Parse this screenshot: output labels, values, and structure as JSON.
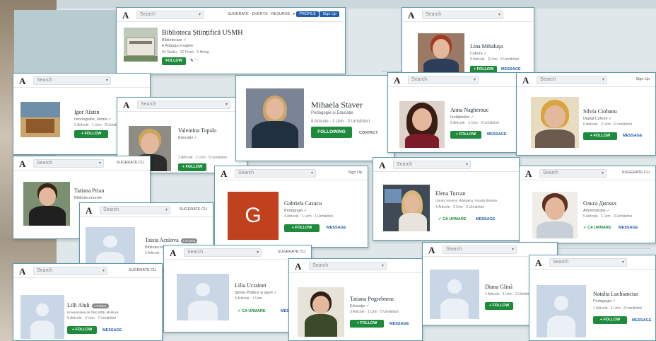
{
  "logo": "A",
  "search_placeholder": "Search",
  "buttons": {
    "follow": "+ FOLLOW",
    "message": "MESSAGE",
    "unfollow": "✓ CA URMARE",
    "contact": "CONTACT"
  },
  "nav": {
    "top_right": "Sign Up",
    "nav_alt": "SUGERATE CU"
  },
  "main_card": {
    "title": "Biblioteca Științifică USMH",
    "meta": "Bibliotecare ✓",
    "stats": "94 Studiu · 12 Posts · 0 Hiring",
    "follow": "FOLLOW"
  },
  "profiles": [
    {
      "id": "lina",
      "name": "Lina Mihalușa",
      "meta": "Cultura ✓",
      "stats": "9 Articole · 3 Urm · 5 Urmăritori"
    },
    {
      "id": "igor",
      "name": "Igor Afatin",
      "meta": "Istoriografie, Istoria ✓",
      "stats": "2 Articole · 1 Urm · 8 Urmăritori"
    },
    {
      "id": "valentina",
      "name": "Valentina Topalo",
      "meta": "Educație ✓",
      "stats": "2 Articole · 1 Urm · 5 Urmăritori"
    },
    {
      "id": "mihaela",
      "name": "Mihaela Staver",
      "meta": "Pedagogie și Educație",
      "stats": "8 Articole · 1 Urm · 3 Urmăritori",
      "follow": "FOLLOWING"
    },
    {
      "id": "anna",
      "name": "Anna Naghernuc",
      "meta": "Învățământ ✓",
      "stats": "5 Articole · 1 Urm · 0 Urmăritori"
    },
    {
      "id": "silvia",
      "name": "Silvia Ciobanu",
      "meta": "Digital Culture ✓",
      "stats": "6 Articole · 2 Urm · 6 Urmăritori"
    },
    {
      "id": "tatiana_p",
      "name": "Tatiana Prian",
      "meta": "Biblioteconomie",
      "stats": ""
    },
    {
      "id": "taisia",
      "name": "Taisia Aculova",
      "badge": "1 Proiect",
      "meta": "Biblioteconomie ✓",
      "stats": "3 Articole · 1 Urm"
    },
    {
      "id": "gabriela",
      "name": "Gabriela Cazacu",
      "meta": "Pedagogie ✓",
      "stats": "4 Articole · 1 Urm · 1 Urmăritori"
    },
    {
      "id": "elena",
      "name": "Elena Turcan",
      "meta": "Library Science, Biblioteca, Faculty librarian",
      "stats": "4 Articole · 2 Urm · 3 Urmăritori"
    },
    {
      "id": "olga",
      "name": "Ольга Дискал",
      "meta": "Administrație ✓",
      "stats": "5 Articole · 1 Urm · 3 Urmăritori"
    },
    {
      "id": "lilia",
      "name": "Lilia Ucrainet",
      "meta": "Științe Politice și sport ✓",
      "stats": "3 Articole · 1 Urm"
    },
    {
      "id": "lilli",
      "name": "Lilli Aluli",
      "badge": "1 Proiect",
      "meta": "Universitatea de Stat, Bălți, Moldova",
      "stats": "5 Articole · 3 Urm · 2 Urmăritori"
    },
    {
      "id": "tatiana_g",
      "name": "Tatiana Pogrebneac",
      "meta": "Educație ✓",
      "stats": "3 Articole · 1 Urm · 5 Urmăritori"
    },
    {
      "id": "diana",
      "name": "Diana Glină",
      "meta": "",
      "stats": "1 Articole · 1 Urm · 2 Urmăritori"
    },
    {
      "id": "natalia",
      "name": "Natalia Luchianciuc",
      "meta": "Pedagogie ✓",
      "stats": "1 Articole · 1 Urm · 4 Urmăritori"
    }
  ],
  "gabriela_initial": "G"
}
